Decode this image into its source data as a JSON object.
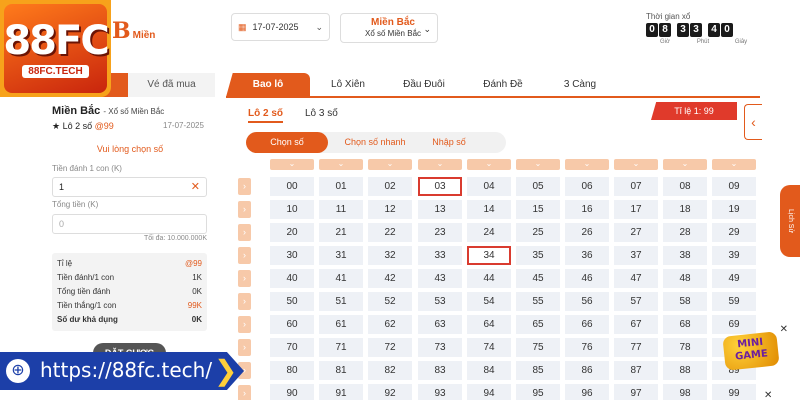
{
  "header": {
    "brand_letter": "B",
    "brand_text": "Miền",
    "date": "17-07-2025",
    "region": "Miền Bắc",
    "region_sub": "Xổ số Miền Bắc",
    "timer_label": "Thời gian xổ",
    "timer_digits": [
      "0",
      "8",
      "3",
      "3",
      "4",
      "0"
    ],
    "timer_units": [
      "Giờ",
      "Phút",
      "Giây"
    ]
  },
  "logo": {
    "big": "88FC",
    "small": "88FC.TECH"
  },
  "left_panel": {
    "tab_betting": "",
    "tab_bought": "Vé đã mua",
    "title": "Miền Bắc",
    "title_sub": "- Xổ số Miền Bắc",
    "bet_type": "★ Lô 2 số",
    "bet_odds": "@99",
    "date": "17-07-2025",
    "prompt": "Vui lòng chọn số",
    "stake_label": "Tiền đánh 1 con (K)",
    "stake_value": "1",
    "total_label": "Tổng tiền (K)",
    "total_placeholder": "0",
    "max_note": "Tối đa: 10.000.000K",
    "summary": [
      {
        "label": "Tỉ lệ",
        "value": "@99"
      },
      {
        "label": "Tiền đánh/1 con",
        "value": "1K"
      },
      {
        "label": "Tổng tiền đánh",
        "value": "0K"
      },
      {
        "label": "Tiền thắng/1 con",
        "value": "99K"
      },
      {
        "label": "Số dư khả dụng",
        "value": "0K"
      }
    ],
    "bet_button": "ĐẶT CƯỢC"
  },
  "main": {
    "tabs": [
      "Bao lô",
      "Lô Xiên",
      "Đầu Đuôi",
      "Đánh Đề",
      "3 Càng"
    ],
    "sub_tabs": [
      "Lô 2 số",
      "Lô 3 số"
    ],
    "ratio": "Tỉ lệ 1: 99",
    "mode_tabs": [
      "Chọn số",
      "Chọn số nhanh",
      "Nhập số"
    ],
    "rows": [
      [
        "00",
        "01",
        "02",
        "03",
        "04",
        "05",
        "06",
        "07",
        "08",
        "09"
      ],
      [
        "10",
        "11",
        "12",
        "13",
        "14",
        "15",
        "16",
        "17",
        "18",
        "19"
      ],
      [
        "20",
        "21",
        "22",
        "23",
        "24",
        "25",
        "26",
        "27",
        "28",
        "29"
      ],
      [
        "30",
        "31",
        "32",
        "33",
        "34",
        "35",
        "36",
        "37",
        "38",
        "39"
      ],
      [
        "40",
        "41",
        "42",
        "43",
        "44",
        "45",
        "46",
        "47",
        "48",
        "49"
      ],
      [
        "50",
        "51",
        "52",
        "53",
        "54",
        "55",
        "56",
        "57",
        "58",
        "59"
      ],
      [
        "60",
        "61",
        "62",
        "63",
        "64",
        "65",
        "66",
        "67",
        "68",
        "69"
      ],
      [
        "70",
        "71",
        "72",
        "73",
        "74",
        "75",
        "76",
        "77",
        "78",
        "79"
      ],
      [
        "80",
        "81",
        "82",
        "83",
        "84",
        "85",
        "86",
        "87",
        "88",
        "89"
      ],
      [
        "90",
        "91",
        "92",
        "93",
        "94",
        "95",
        "96",
        "97",
        "98",
        "99"
      ]
    ],
    "selected": [
      "03",
      "34"
    ]
  },
  "side": {
    "fab_label": "Lịch Sử",
    "mini_game": "MINI GAME"
  },
  "banner": {
    "url": "https://88fc.tech/"
  }
}
